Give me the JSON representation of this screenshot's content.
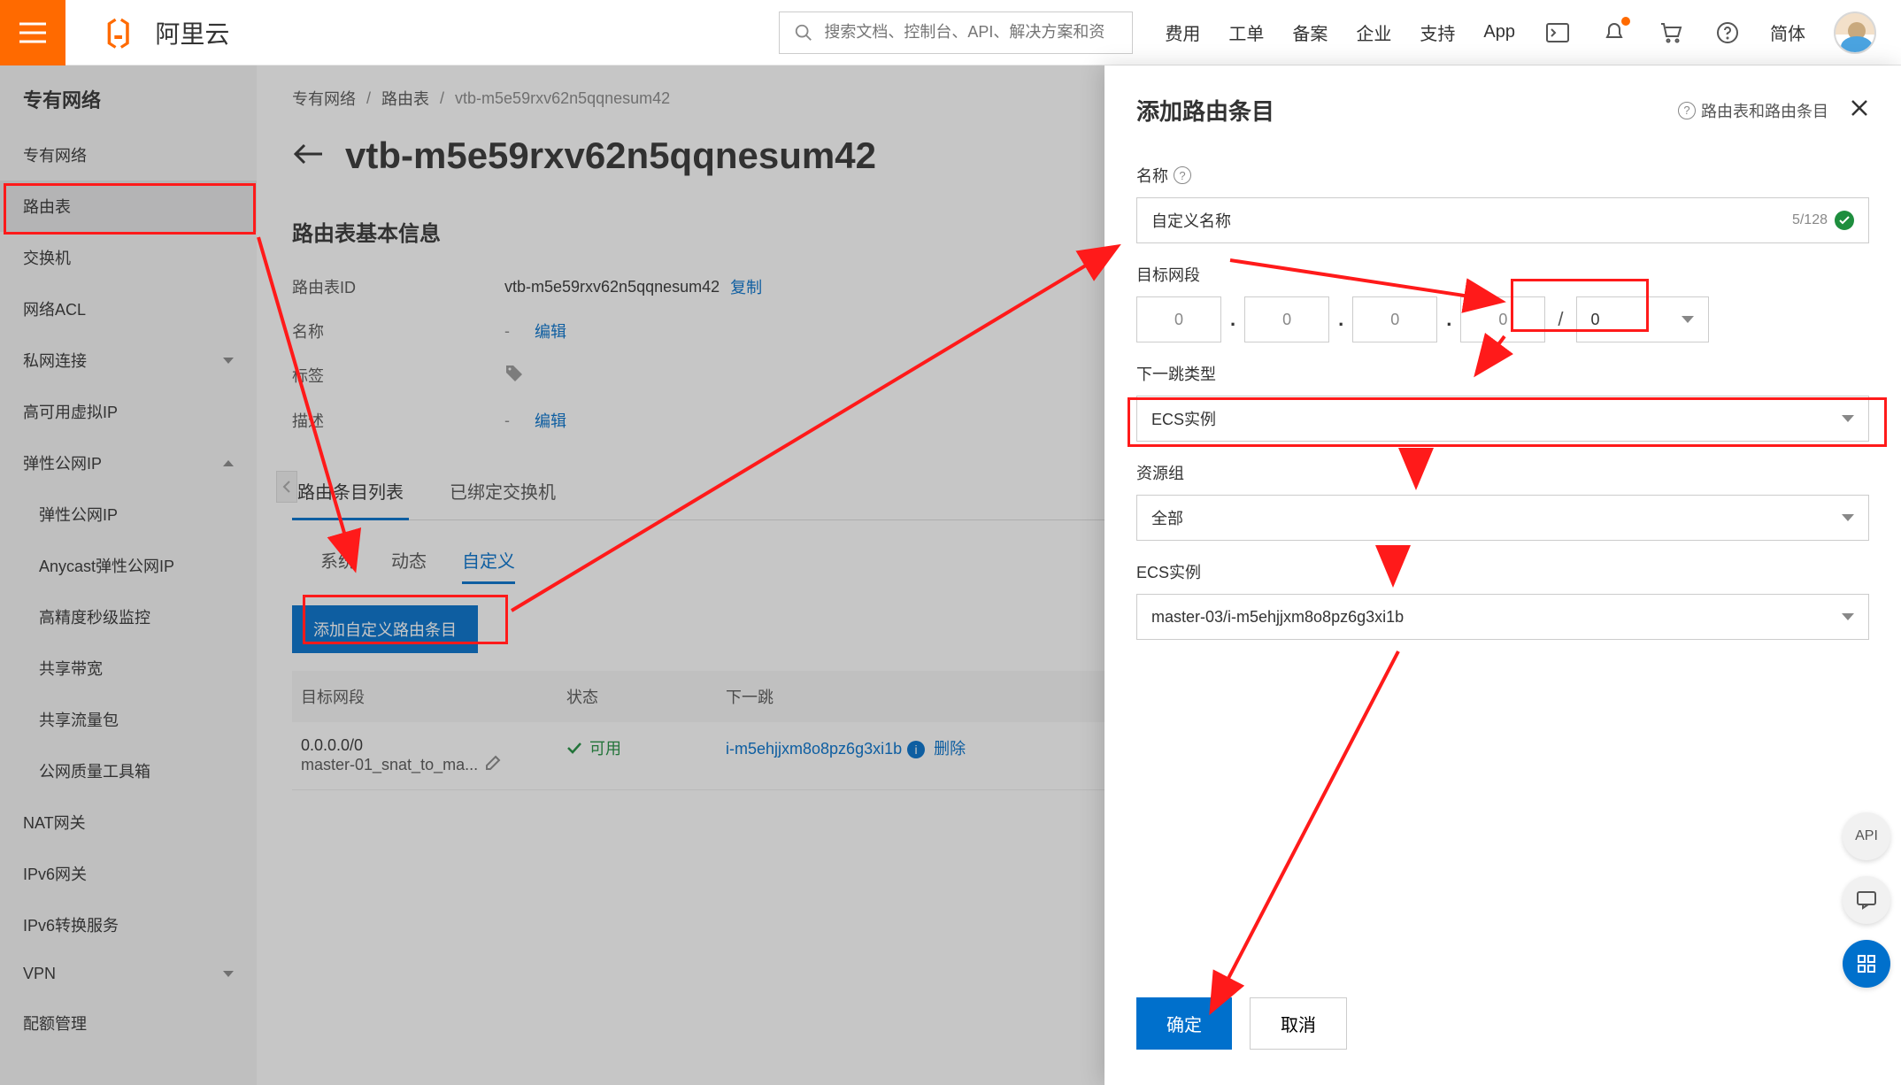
{
  "header": {
    "logo_text": "阿里云",
    "search_placeholder": "搜索文档、控制台、API、解决方案和资",
    "nav": [
      "费用",
      "工单",
      "备案",
      "企业",
      "支持",
      "App"
    ],
    "lang": "简体"
  },
  "sidebar": {
    "title": "专有网络",
    "items": [
      {
        "label": "专有网络"
      },
      {
        "label": "路由表",
        "active": true
      },
      {
        "label": "交换机"
      },
      {
        "label": "网络ACL"
      },
      {
        "label": "私网连接",
        "exp": "down"
      },
      {
        "label": "高可用虚拟IP"
      },
      {
        "label": "弹性公网IP",
        "exp": "up"
      },
      {
        "label": "弹性公网IP",
        "child": true
      },
      {
        "label": "Anycast弹性公网IP",
        "child": true
      },
      {
        "label": "高精度秒级监控",
        "child": true
      },
      {
        "label": "共享带宽",
        "child": true
      },
      {
        "label": "共享流量包",
        "child": true
      },
      {
        "label": "公网质量工具箱",
        "child": true
      },
      {
        "label": "NAT网关"
      },
      {
        "label": "IPv6网关"
      },
      {
        "label": "IPv6转换服务"
      },
      {
        "label": "VPN",
        "exp": "down"
      },
      {
        "label": "配额管理"
      }
    ]
  },
  "breadcrumb": {
    "a": "专有网络",
    "b": "路由表",
    "c": "vtb-m5e59rxv62n5qqnesum42"
  },
  "page": {
    "title": "vtb-m5e59rxv62n5qqnesum42",
    "section_title": "路由表基本信息",
    "info": {
      "id_label": "路由表ID",
      "id_val": "vtb-m5e59rxv62n5qqnesum42",
      "copy": "复制",
      "name_label": "名称",
      "edit": "编辑",
      "tag_label": "标签",
      "desc_label": "描述"
    },
    "tabs": {
      "routes": "路由条目列表",
      "switches": "已绑定交换机"
    },
    "subtabs": {
      "sys": "系统",
      "dyn": "动态",
      "custom": "自定义"
    },
    "add_btn": "添加自定义路由条目",
    "table": {
      "h1": "目标网段",
      "h2": "状态",
      "h3": "下一跳",
      "cidr": "0.0.0.0/0",
      "name": "master-01_snat_to_ma...",
      "status": "可用",
      "hop": "i-m5ehjjxm8o8pz6g3xi1b",
      "del": "删除"
    }
  },
  "drawer": {
    "title": "添加路由条目",
    "help": "路由表和路由条目",
    "name_label": "名称",
    "name_value": "自定义名称",
    "counter": "5/128",
    "cidr_label": "目标网段",
    "oct": "0",
    "prefix": "0",
    "hop_type_label": "下一跳类型",
    "hop_type_value": "ECS实例",
    "rg_label": "资源组",
    "rg_value": "全部",
    "ecs_label": "ECS实例",
    "ecs_value": "master-03/i-m5ehjjxm8o8pz6g3xi1b",
    "ok": "确定",
    "cancel": "取消"
  },
  "float": {
    "api": "API"
  }
}
